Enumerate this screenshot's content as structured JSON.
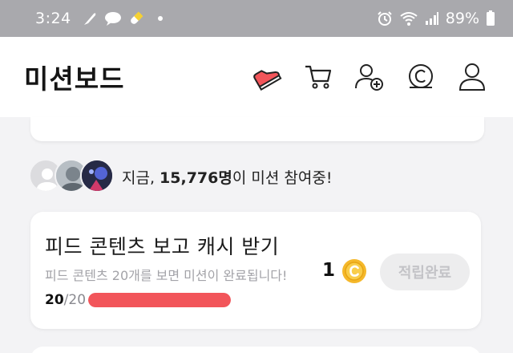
{
  "status_bar": {
    "time": "3:24",
    "battery": "89%"
  },
  "header": {
    "title": "미션보드",
    "icons": [
      "sneaker-icon",
      "cart-icon",
      "add-friend-icon",
      "cash-coin-icon",
      "profile-icon"
    ]
  },
  "participants": {
    "prefix": "지금, ",
    "count": "15,776명",
    "suffix": "이 미션 참여중!"
  },
  "mission": {
    "title": "피드 콘텐츠 보고 캐시 받기",
    "description": "피드 콘텐츠 20개를 보면 미션이 완료됩니다!",
    "reward": "1",
    "claim_label": "적립완료",
    "progress_current": "20",
    "progress_total": "/20",
    "progress_fraction": 1.0
  },
  "colors": {
    "accent": "#f2555a",
    "coin": "#f5b82a",
    "status_bar": "#a9a9ad"
  }
}
